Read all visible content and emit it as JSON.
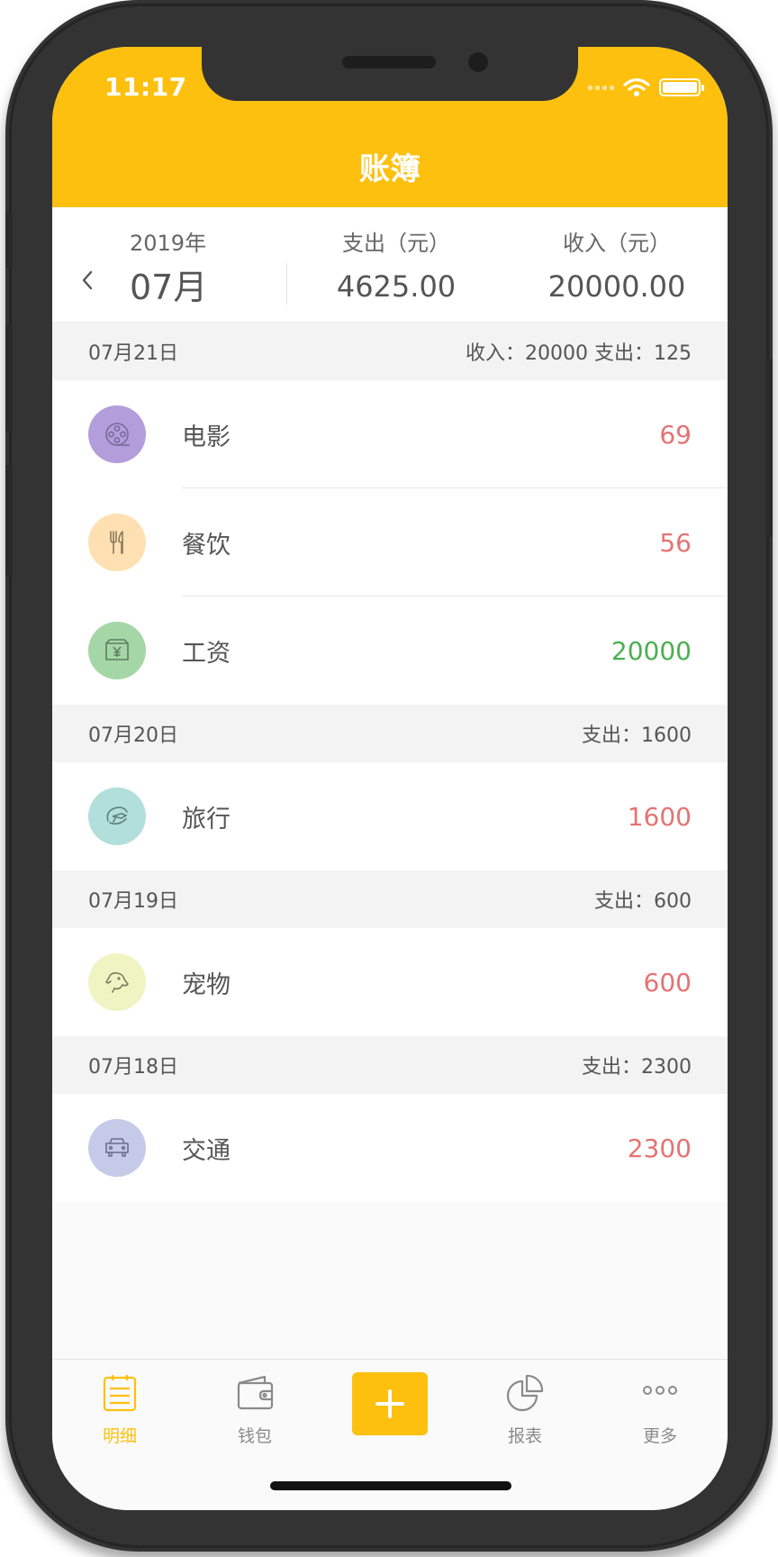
{
  "status_bar": {
    "time": "11:17"
  },
  "nav": {
    "title": "账簿"
  },
  "summary": {
    "year": "2019年",
    "month": "07月",
    "expense_label": "支出（元）",
    "expense_value": "4625.00",
    "income_label": "收入（元）",
    "income_value": "20000.00"
  },
  "days": [
    {
      "date": "07月21日",
      "summary": "收入：20000 支出：125",
      "items": [
        {
          "name": "电影",
          "amount": "69",
          "kind": "expense",
          "icon": "film-reel-icon",
          "icon_bg": "#b39ddb"
        },
        {
          "name": "餐饮",
          "amount": "56",
          "kind": "expense",
          "icon": "fork-knife-icon",
          "icon_bg": "#ffe0b2"
        },
        {
          "name": "工资",
          "amount": "20000",
          "kind": "income",
          "icon": "salary-envelope-icon",
          "icon_bg": "#a5d6a7"
        }
      ]
    },
    {
      "date": "07月20日",
      "summary": "支出：1600",
      "items": [
        {
          "name": "旅行",
          "amount": "1600",
          "kind": "expense",
          "icon": "travel-plane-icon",
          "icon_bg": "#b2dfdb"
        }
      ]
    },
    {
      "date": "07月19日",
      "summary": "支出：600",
      "items": [
        {
          "name": "宠物",
          "amount": "600",
          "kind": "expense",
          "icon": "pet-dog-icon",
          "icon_bg": "#f0f4c3"
        }
      ]
    },
    {
      "date": "07月18日",
      "summary": "支出：2300",
      "items": [
        {
          "name": "交通",
          "amount": "2300",
          "kind": "expense",
          "icon": "car-icon",
          "icon_bg": "#c5cae9"
        }
      ]
    }
  ],
  "tabs": {
    "details": "明细",
    "wallet": "钱包",
    "report": "报表",
    "more": "更多"
  },
  "colors": {
    "accent": "#fdc00f",
    "expense": "#e57373",
    "income": "#4caf50"
  }
}
